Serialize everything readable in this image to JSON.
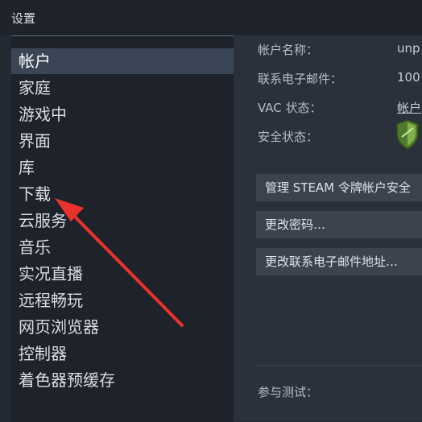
{
  "window": {
    "title": "设置"
  },
  "sidebar": {
    "items": [
      {
        "label": "帐户"
      },
      {
        "label": "家庭"
      },
      {
        "label": "游戏中"
      },
      {
        "label": "界面"
      },
      {
        "label": "库"
      },
      {
        "label": "下载"
      },
      {
        "label": "云服务"
      },
      {
        "label": "音乐"
      },
      {
        "label": "实况直播"
      },
      {
        "label": "远程畅玩"
      },
      {
        "label": "网页浏览器"
      },
      {
        "label": "控制器"
      },
      {
        "label": "着色器预缓存"
      }
    ],
    "active_index": 0
  },
  "account": {
    "name_label": "帐户名称：",
    "name_value": "unp",
    "email_label": "联系电子邮件：",
    "email_value": "100",
    "vac_label": "VAC 状态：",
    "vac_value": "帐户",
    "security_label": "安全状态：",
    "security_icon": "shield-icon",
    "buttons": {
      "steam_guard": "管理 STEAM 令牌帐户安全",
      "change_password": "更改密码…",
      "change_email": "更改联系电子邮件地址…"
    },
    "beta_label": "参与测试："
  },
  "colors": {
    "accent_arrow": "#e8322b",
    "shield_green": "#6a9a3e"
  }
}
